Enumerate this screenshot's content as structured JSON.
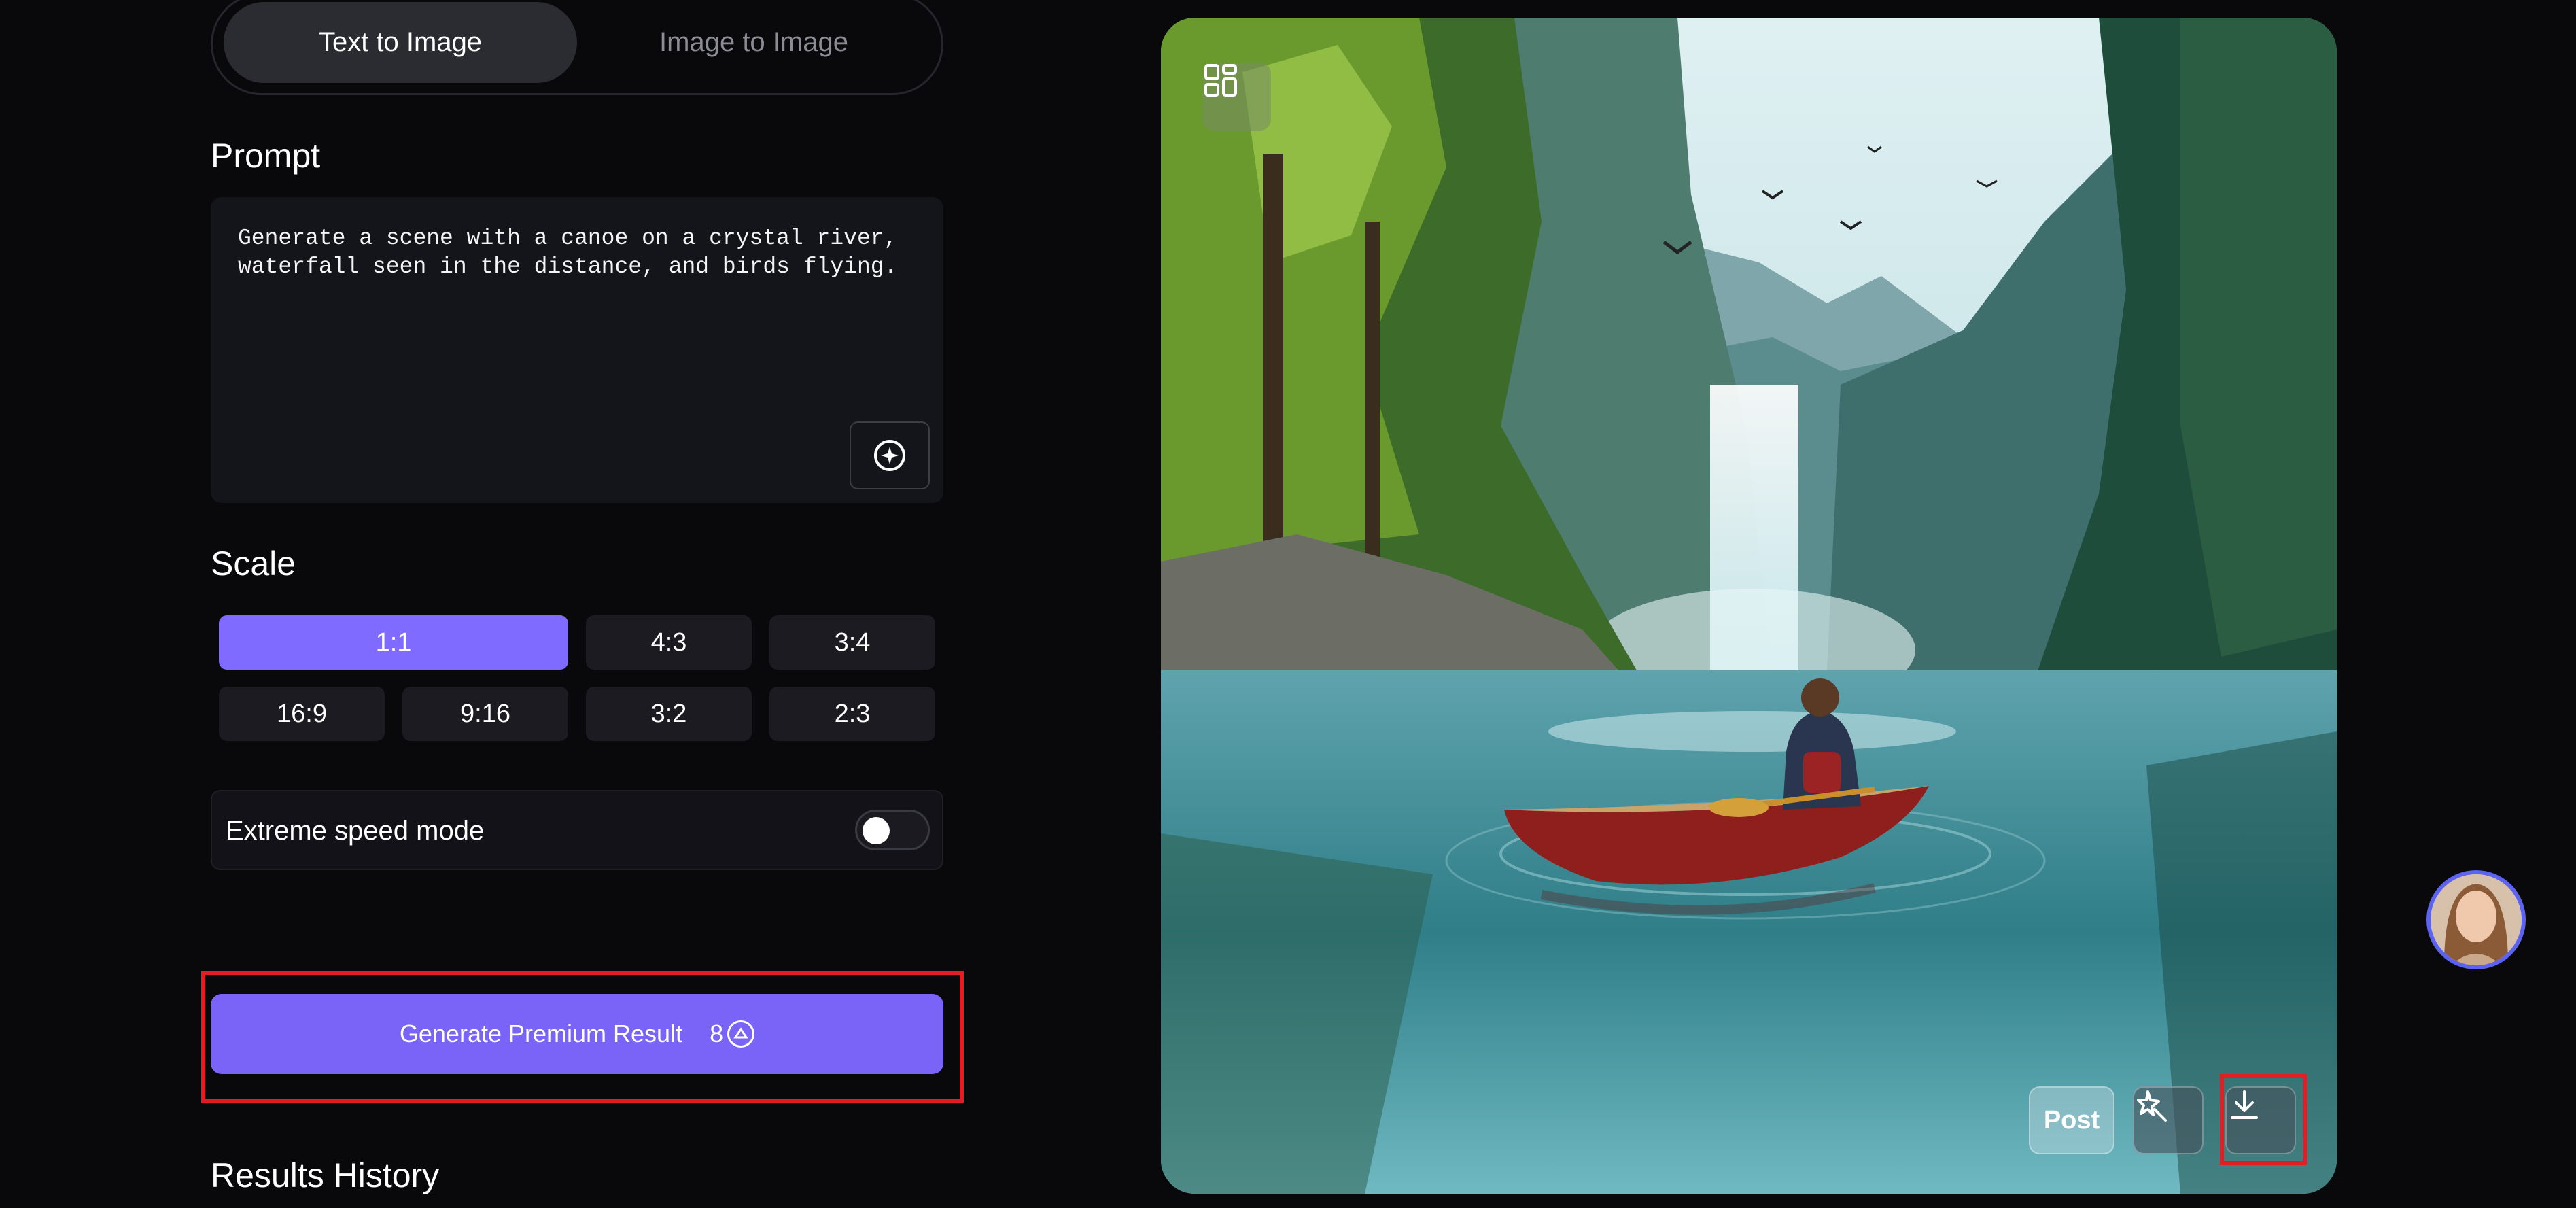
{
  "tabs": [
    {
      "label": "Text to Image",
      "active": true
    },
    {
      "label": "Image to Image",
      "active": false
    }
  ],
  "prompt": {
    "label": "Prompt",
    "value": "Generate a scene with a canoe on a crystal river,\nwaterfall seen in the distance, and birds flying.",
    "enhance_icon": "sparkle-icon"
  },
  "scale": {
    "label": "Scale",
    "selected": "1:1",
    "options": [
      "1:1",
      "4:3",
      "3:4",
      "16:9",
      "9:16",
      "3:2",
      "2:3"
    ]
  },
  "speed_mode": {
    "label": "Extreme speed mode",
    "enabled": false
  },
  "generate": {
    "label": "Generate Premium Result",
    "cost": "8",
    "cost_icon": "credit-coin-icon"
  },
  "results_history": {
    "label": "Results History"
  },
  "image_actions": {
    "post_label": "Post",
    "layout_icon": "grid-layout-icon",
    "enhance_icon": "magic-wand-icon",
    "download_icon": "download-icon"
  },
  "colors": {
    "accent": "#7a63f7",
    "selected_scale": "#7f6bff",
    "highlight": "#e01e24",
    "background": "#09090b"
  }
}
